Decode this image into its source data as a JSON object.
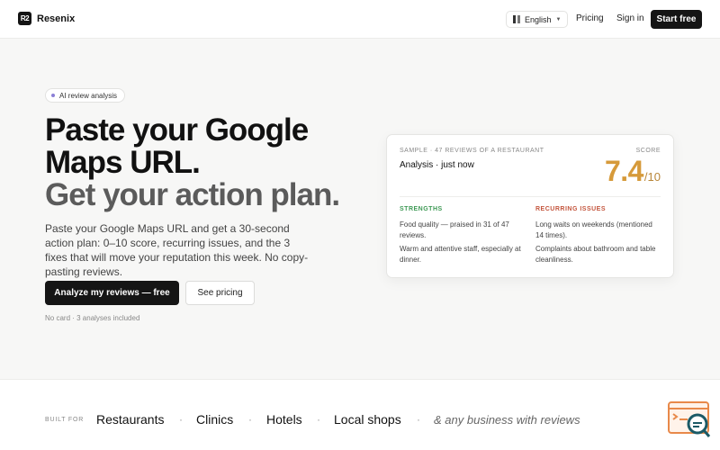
{
  "header": {
    "logo_mark": "R2",
    "brand": "Resenix",
    "language": "English",
    "nav": {
      "pricing": "Pricing",
      "signin": "Sign in"
    },
    "start_label": "Start free"
  },
  "hero": {
    "pill": "AI review analysis",
    "headline_line1": "Paste your Google",
    "headline_line2": "Maps URL.",
    "headline_line3": "Get your action plan.",
    "subtext": "Paste your Google Maps URL and get a 30-second action plan: 0–10 score, recurring issues, and the 3 fixes that will move your reputation this week. No copy-pasting reviews.",
    "cta_primary": "Analyze my reviews — free",
    "cta_secondary": "See pricing",
    "fine_print": "No card · 3 analyses included"
  },
  "sample_card": {
    "kicker": "SAMPLE · 47 REVIEWS OF A RESTAURANT",
    "title": "Analysis · just now",
    "score_label": "SCORE",
    "score": "7.4",
    "score_max": "/10",
    "score_color": "#d69a3a",
    "strengths_label": "STRENGTHS",
    "strengths_color": "#3f9a56",
    "strengths": [
      "Food quality — praised in 31 of 47 reviews.",
      "Warm and attentive staff, especially at dinner."
    ],
    "issues_label": "RECURRING ISSUES",
    "issues_color": "#c4563e",
    "issues": [
      "Long waits on weekends (mentioned 14 times).",
      "Complaints about bathroom and table cleanliness."
    ]
  },
  "built_for": {
    "label": "BUILT FOR",
    "industries": [
      "Restaurants",
      "Clinics",
      "Hotels",
      "Local shops"
    ],
    "separator": "·",
    "tail": "& any business with reviews"
  },
  "widget": {
    "icon": "chat-search-icon"
  }
}
